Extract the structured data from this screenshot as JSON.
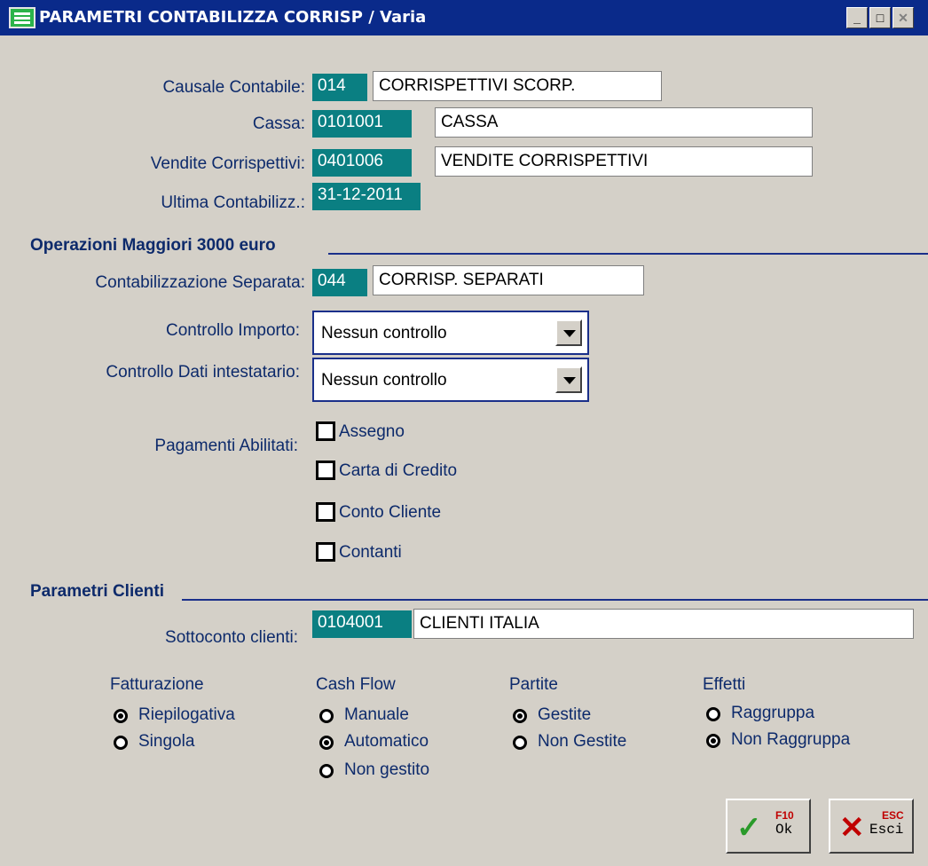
{
  "window": {
    "title": "PARAMETRI CONTABILIZZA CORRISP / Varia",
    "icon": "form-icon",
    "controls": [
      "minimize-icon",
      "maximize-icon",
      "close-icon"
    ]
  },
  "fields": {
    "causale": {
      "label": "Causale Contabile:",
      "code": "014",
      "desc": "CORRISPETTIVI SCORP."
    },
    "cassa": {
      "label": "Cassa:",
      "code": "0101001",
      "desc": "CASSA"
    },
    "vendite": {
      "label": "Vendite Corrispettivi:",
      "code": "0401006",
      "desc": "VENDITE CORRISPETTIVI"
    },
    "ultima": {
      "label": "Ultima Contabilizz.:",
      "value": "31-12-2011"
    }
  },
  "operazioni": {
    "title": "Operazioni Maggiori 3000 euro",
    "separata": {
      "label": "Contabilizzazione Separata:",
      "code": "044",
      "desc": "CORRISP. SEPARATI"
    },
    "controllo_importo": {
      "label": "Controllo Importo:",
      "value": "Nessun controllo"
    },
    "controllo_dati": {
      "label": "Controllo Dati intestatario:",
      "value": "Nessun controllo"
    },
    "pagamenti_label": "Pagamenti Abilitati:",
    "pagamenti": [
      {
        "label": "Assegno",
        "checked": false
      },
      {
        "label": "Carta di Credito",
        "checked": false
      },
      {
        "label": "Conto Cliente",
        "checked": false
      },
      {
        "label": "Contanti",
        "checked": false
      }
    ]
  },
  "clienti": {
    "title": "Parametri Clienti",
    "sottoconto": {
      "label": "Sottoconto clienti:",
      "code": "0104001",
      "desc": "CLIENTI  ITALIA"
    },
    "groups": {
      "fatturazione": {
        "title": "Fatturazione",
        "options": [
          "Riepilogativa",
          "Singola"
        ],
        "selected": "Riepilogativa"
      },
      "cashflow": {
        "title": "Cash Flow",
        "options": [
          "Manuale",
          "Automatico",
          "Non gestito"
        ],
        "selected": "Automatico"
      },
      "partite": {
        "title": "Partite",
        "options": [
          "Gestite",
          "Non Gestite"
        ],
        "selected": "Gestite"
      },
      "effetti": {
        "title": "Effetti",
        "options": [
          "Raggruppa",
          "Non Raggruppa"
        ],
        "selected": "Non Raggruppa"
      }
    }
  },
  "buttons": {
    "ok": {
      "key": "F10",
      "label": "Ok",
      "icon": "checkmark-icon",
      "color": "#2a9a2a"
    },
    "esci": {
      "key": "ESC",
      "label": "Esci",
      "icon": "x-icon",
      "color": "#c00000"
    }
  }
}
